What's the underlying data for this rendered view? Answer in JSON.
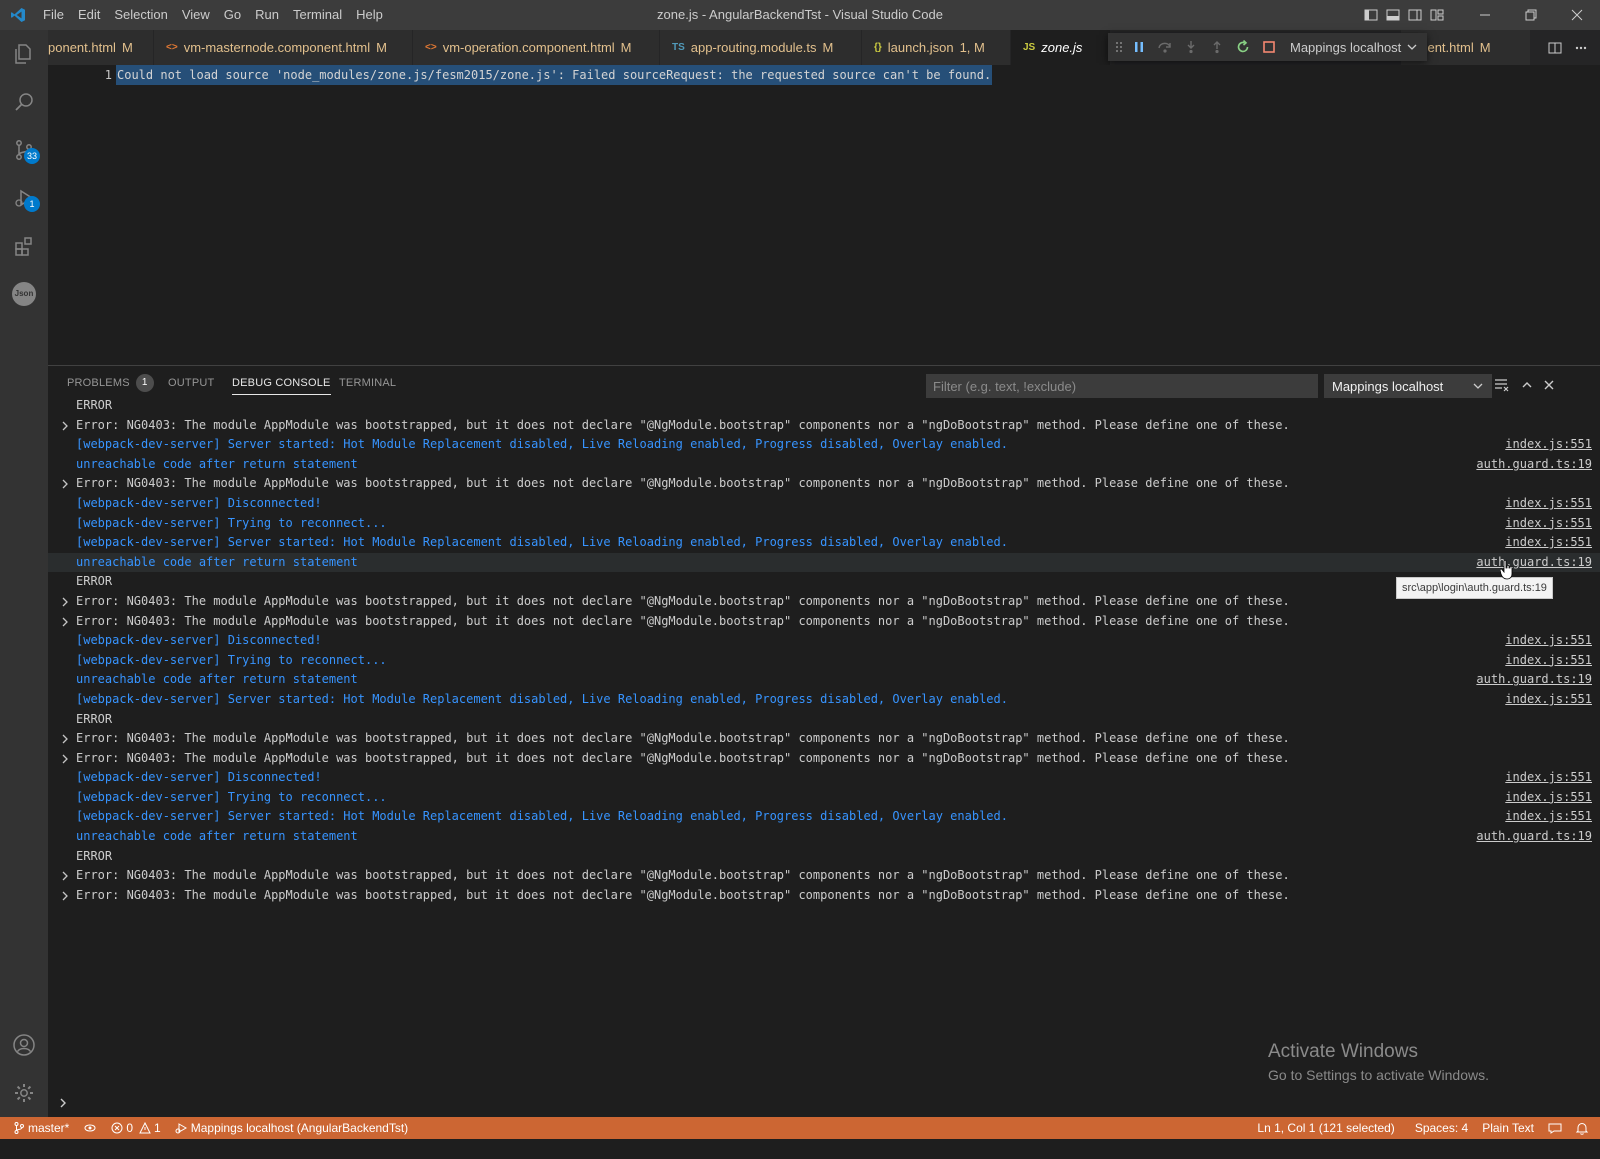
{
  "window": {
    "title": "zone.js - AngularBackendTst - Visual Studio Code"
  },
  "menu": [
    "File",
    "Edit",
    "Selection",
    "View",
    "Go",
    "Run",
    "Terminal",
    "Help"
  ],
  "activity": {
    "scm_badge": "33",
    "debug_badge": "1",
    "json_label": "Json"
  },
  "tabs": [
    {
      "label": "ponent.html",
      "icon": "",
      "mod": "M"
    },
    {
      "label": "vm-masternode.component.html",
      "icon": "<>",
      "mod": "M"
    },
    {
      "label": "vm-operation.component.html",
      "icon": "<>",
      "mod": "M"
    },
    {
      "label": "app-routing.module.ts",
      "icon": "TS",
      "mod": "M"
    },
    {
      "label": "launch.json",
      "icon": "{}",
      "mod": "1, M"
    },
    {
      "label": "zone.js",
      "icon": "JS",
      "mod": ""
    },
    {
      "label": "onent.html",
      "icon": "",
      "mod": "M"
    }
  ],
  "debug_toolbar": {
    "config": "Mappings localhost"
  },
  "editor": {
    "line_number": "1",
    "line_text": "Could not load source 'node_modules/zone.js/fesm2015/zone.js': Failed sourceRequest: the requested source can't be found."
  },
  "panel": {
    "tabs": {
      "problems": "PROBLEMS",
      "problems_count": "1",
      "output": "OUTPUT",
      "debug_console": "DEBUG CONSOLE",
      "terminal": "TERMINAL"
    },
    "filter_placeholder": "Filter (e.g. text, !exclude)",
    "config_select": "Mappings localhost"
  },
  "console_lines": [
    {
      "expand": false,
      "color": "gray",
      "text": "ERROR",
      "src": ""
    },
    {
      "expand": true,
      "color": "gray",
      "text": "Error: NG0403: The module AppModule was bootstrapped, but it does not declare \"@NgModule.bootstrap\" components nor a \"ngDoBootstrap\" method. Please define one of these.",
      "src": ""
    },
    {
      "expand": false,
      "color": "blue",
      "text": "[webpack-dev-server] Server started: Hot Module Replacement disabled, Live Reloading enabled, Progress disabled, Overlay enabled.",
      "src": "index.js:551"
    },
    {
      "expand": false,
      "color": "blue",
      "text": "unreachable code after return statement",
      "src": "auth.guard.ts:19"
    },
    {
      "expand": true,
      "color": "gray",
      "text": "Error: NG0403: The module AppModule was bootstrapped, but it does not declare \"@NgModule.bootstrap\" components nor a \"ngDoBootstrap\" method. Please define one of these.",
      "src": ""
    },
    {
      "expand": false,
      "color": "blue",
      "text": "[webpack-dev-server] Disconnected!",
      "src": "index.js:551"
    },
    {
      "expand": false,
      "color": "blue",
      "text": "[webpack-dev-server] Trying to reconnect...",
      "src": "index.js:551"
    },
    {
      "expand": false,
      "color": "blue",
      "text": "[webpack-dev-server] Server started: Hot Module Replacement disabled, Live Reloading enabled, Progress disabled, Overlay enabled.",
      "src": "index.js:551"
    },
    {
      "expand": false,
      "color": "blue",
      "text": "unreachable code after return statement",
      "src": "auth.guard.ts:19",
      "hover": true
    },
    {
      "expand": false,
      "color": "gray",
      "text": "ERROR",
      "src": ""
    },
    {
      "expand": true,
      "color": "gray",
      "text": "Error: NG0403: The module AppModule was bootstrapped, but it does not declare \"@NgModule.bootstrap\" components nor a \"ngDoBootstrap\" method. Please define one of these.",
      "src": ""
    },
    {
      "expand": true,
      "color": "gray",
      "text": "Error: NG0403: The module AppModule was bootstrapped, but it does not declare \"@NgModule.bootstrap\" components nor a \"ngDoBootstrap\" method. Please define one of these.",
      "src": ""
    },
    {
      "expand": false,
      "color": "blue",
      "text": "[webpack-dev-server] Disconnected!",
      "src": "index.js:551"
    },
    {
      "expand": false,
      "color": "blue",
      "text": "[webpack-dev-server] Trying to reconnect...",
      "src": "index.js:551"
    },
    {
      "expand": false,
      "color": "blue",
      "text": "unreachable code after return statement",
      "src": "auth.guard.ts:19"
    },
    {
      "expand": false,
      "color": "blue",
      "text": "[webpack-dev-server] Server started: Hot Module Replacement disabled, Live Reloading enabled, Progress disabled, Overlay enabled.",
      "src": "index.js:551"
    },
    {
      "expand": false,
      "color": "gray",
      "text": "ERROR",
      "src": ""
    },
    {
      "expand": true,
      "color": "gray",
      "text": "Error: NG0403: The module AppModule was bootstrapped, but it does not declare \"@NgModule.bootstrap\" components nor a \"ngDoBootstrap\" method. Please define one of these.",
      "src": ""
    },
    {
      "expand": true,
      "color": "gray",
      "text": "Error: NG0403: The module AppModule was bootstrapped, but it does not declare \"@NgModule.bootstrap\" components nor a \"ngDoBootstrap\" method. Please define one of these.",
      "src": ""
    },
    {
      "expand": false,
      "color": "blue",
      "text": "[webpack-dev-server] Disconnected!",
      "src": "index.js:551"
    },
    {
      "expand": false,
      "color": "blue",
      "text": "[webpack-dev-server] Trying to reconnect...",
      "src": "index.js:551"
    },
    {
      "expand": false,
      "color": "blue",
      "text": "[webpack-dev-server] Server started: Hot Module Replacement disabled, Live Reloading enabled, Progress disabled, Overlay enabled.",
      "src": "index.js:551"
    },
    {
      "expand": false,
      "color": "blue",
      "text": "unreachable code after return statement",
      "src": "auth.guard.ts:19"
    },
    {
      "expand": false,
      "color": "gray",
      "text": "ERROR",
      "src": ""
    },
    {
      "expand": true,
      "color": "gray",
      "text": "Error: NG0403: The module AppModule was bootstrapped, but it does not declare \"@NgModule.bootstrap\" components nor a \"ngDoBootstrap\" method. Please define one of these.",
      "src": ""
    },
    {
      "expand": true,
      "color": "gray",
      "text": "Error: NG0403: The module AppModule was bootstrapped, but it does not declare \"@NgModule.bootstrap\" components nor a \"ngDoBootstrap\" method. Please define one of these.",
      "src": ""
    }
  ],
  "tooltip": "src\\app\\login\\auth.guard.ts:19",
  "watermark": {
    "title": "Activate Windows",
    "subtitle": "Go to Settings to activate Windows."
  },
  "statusbar": {
    "branch": "master*",
    "errors": "0",
    "warnings": "1",
    "debug_config": "Mappings localhost (AngularBackendTst)",
    "cursor": "Ln 1, Col 1 (121 selected)",
    "spaces": "Spaces: 4",
    "language": "Plain Text"
  },
  "colors": {
    "statusbar": "#cc6633",
    "accent": "#007acc",
    "console_blue": "#3794ff"
  }
}
